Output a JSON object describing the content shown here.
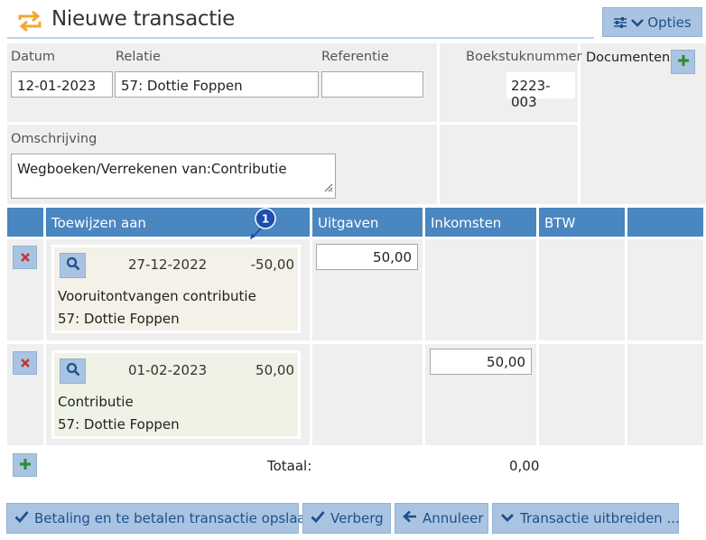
{
  "header": {
    "title": "Nieuwe transactie",
    "options_label": "Opties"
  },
  "form": {
    "datum_label": "Datum",
    "datum_value": "12-01-2023",
    "relatie_label": "Relatie",
    "relatie_value": "57: Dottie Foppen",
    "referentie_label": "Referentie",
    "referentie_value": "",
    "boekstuk_label": "Boekstuknummer",
    "boekstuk_value": "2223-003",
    "documenten_label": "Documenten",
    "omschrijving_label": "Omschrijving",
    "omschrijving_value": "Wegboeken/Verrekenen van:Contributie"
  },
  "table": {
    "columns": [
      "Toewijzen aan",
      "Uitgaven",
      "Inkomsten",
      "BTW"
    ],
    "rows": [
      {
        "date": "27-12-2022",
        "amount": "-50,00",
        "description": "Vooruitontvangen contributie",
        "relation": "57: Dottie Foppen",
        "uitgaven": "50,00",
        "inkomsten": ""
      },
      {
        "date": "01-02-2023",
        "amount": "50,00",
        "description": "Contributie",
        "relation": "57: Dottie Foppen",
        "uitgaven": "",
        "inkomsten": "50,00"
      }
    ],
    "totaal_label": "Totaal:",
    "totaal_value": "0,00",
    "badge_number": "1"
  },
  "actions": {
    "save_label": "Betaling en te betalen transactie opslaan",
    "hide_label": "Verberg",
    "cancel_label": "Annuleer",
    "expand_label": "Transactie uitbreiden ..."
  },
  "colors": {
    "accent": "#4a86c0",
    "button_bg": "#a9c4e2",
    "title_icon": "#f0a830",
    "delete_icon": "#c0392b",
    "add_icon": "#2e8b2e"
  },
  "icons": {
    "title": "transfer-arrows-icon",
    "options": "sliders-icon",
    "add": "plus-icon",
    "delete": "close-icon",
    "search": "search-icon",
    "save": "check-icon",
    "hide": "check-icon",
    "cancel": "arrow-left-icon",
    "expand": "chevron-down-icon"
  }
}
